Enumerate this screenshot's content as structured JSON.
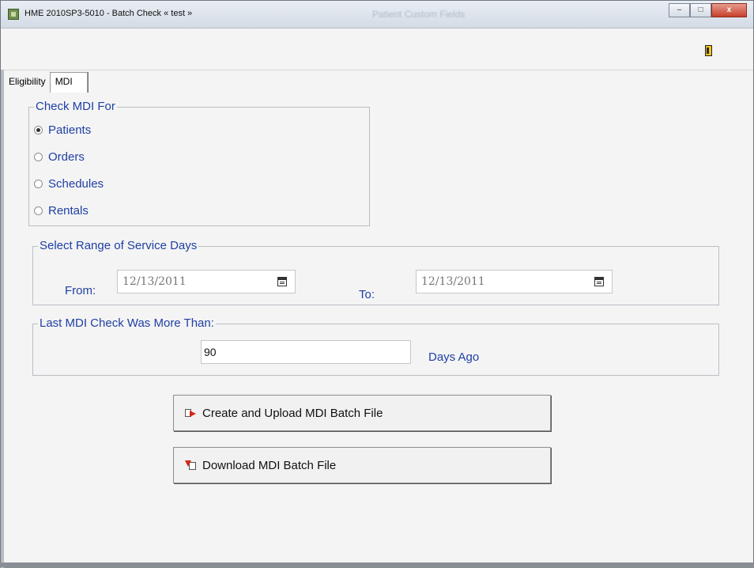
{
  "window": {
    "title": "HME 2010SP3-5010 - Batch Check « test »",
    "background_title": "Patient Custom Fields",
    "caption": {
      "minimize": "–",
      "maximize": "□",
      "close": "x"
    }
  },
  "tabs": [
    {
      "label": "Eligibility"
    },
    {
      "label": "MDI",
      "active": true
    }
  ],
  "check_for": {
    "legend": "Check MDI For",
    "options": [
      {
        "label": "Patients",
        "checked": true
      },
      {
        "label": "Orders",
        "checked": false
      },
      {
        "label": "Schedules",
        "checked": false
      },
      {
        "label": "Rentals",
        "checked": false
      }
    ]
  },
  "service_range": {
    "legend": "Select Range of Service Days",
    "from_label": "From:",
    "from_value": "12/13/2011",
    "to_label": "To:",
    "to_value": "12/13/2011"
  },
  "last_check": {
    "legend": "Last MDI Check Was More Than:",
    "days_value": "90",
    "suffix": "Days Ago"
  },
  "buttons": {
    "create_upload": "Create and Upload MDI Batch File",
    "download": "Download MDI Batch File"
  },
  "icons": {
    "app": "app-icon",
    "exit": "exit-door-icon",
    "calendar": "calendar-icon",
    "upload": "upload-file-icon",
    "download": "download-file-icon"
  },
  "colors": {
    "label_blue": "#1f3fa3",
    "window_bg": "#f4f4f4",
    "close_red": "#c7402b"
  }
}
